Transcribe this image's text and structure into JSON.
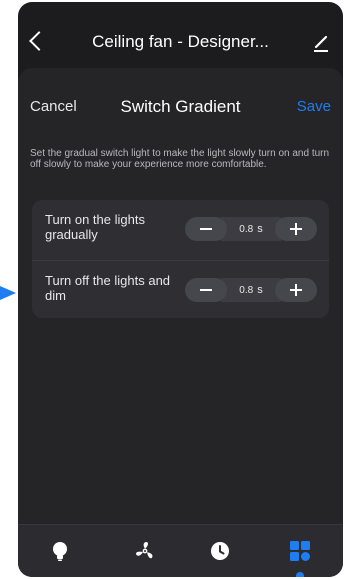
{
  "header": {
    "title": "Ceiling fan - Designer..."
  },
  "sheet": {
    "cancel_label": "Cancel",
    "title": "Switch Gradient",
    "save_label": "Save",
    "description": "Set the gradual switch light to make the light slowly turn on and turn off slowly to make your experience more comfortable."
  },
  "settings": [
    {
      "label": "Turn on the lights gradually",
      "value": "0.8",
      "unit": "s"
    },
    {
      "label": "Turn off the lights and dim",
      "value": "0.8",
      "unit": "s"
    }
  ],
  "tabbar": {
    "tabs": [
      {
        "icon": "bulb-icon"
      },
      {
        "icon": "fan-icon"
      },
      {
        "icon": "clock-icon"
      },
      {
        "icon": "grid-icon",
        "active": true
      }
    ]
  },
  "colors": {
    "accent": "#1f7df3",
    "background": "#1c1c1e",
    "sheet": "#252528",
    "card": "#2e2e33"
  }
}
